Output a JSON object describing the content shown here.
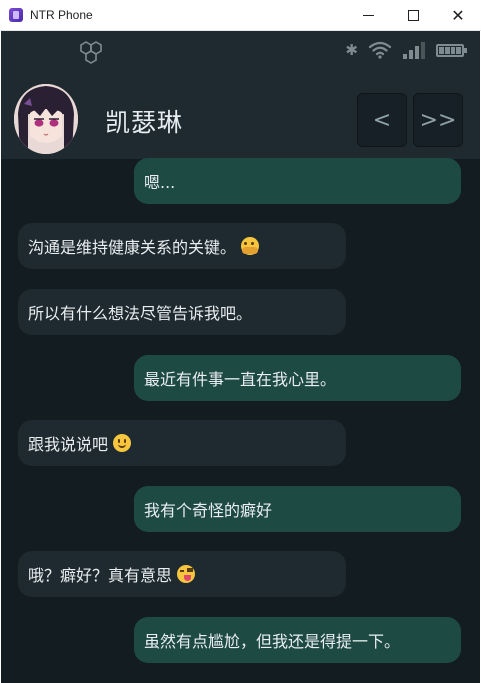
{
  "window": {
    "title": "NTR Phone",
    "close_glyph": "✕"
  },
  "status_bar": {
    "left_icon": "hexagon-cluster-icon",
    "icons": [
      "bluetooth-icon",
      "wifi-icon",
      "signal-icon",
      "battery-icon"
    ],
    "bluetooth_glyph": "✱"
  },
  "header": {
    "contact_name": "凯瑟琳",
    "prev_label": "<",
    "next_label": ">>"
  },
  "colors": {
    "phone_bg": "#131c21",
    "header_bg": "#1e2a30",
    "outgoing_bubble": "#1e4a44",
    "incoming_bubble": "#1f2a30",
    "text": "#e9eef0"
  },
  "messages": [
    {
      "side": "me",
      "text": "嗯..."
    },
    {
      "side": "them",
      "text": "沟通是维持健康关系的关键。",
      "emoji": "hugging-face-emoji"
    },
    {
      "side": "them",
      "text": "所以有什么想法尽管告诉我吧。"
    },
    {
      "side": "me",
      "text": "最近有件事一直在我心里。"
    },
    {
      "side": "them",
      "text": "跟我说说吧",
      "emoji": "smiling-face-emoji"
    },
    {
      "side": "me",
      "text": "我有个奇怪的癖好"
    },
    {
      "side": "them",
      "text": "哦？癖好？真有意思",
      "emoji": "winking-tongue-emoji"
    },
    {
      "side": "me",
      "text": "虽然有点尴尬，但我还是得提一下。"
    }
  ]
}
